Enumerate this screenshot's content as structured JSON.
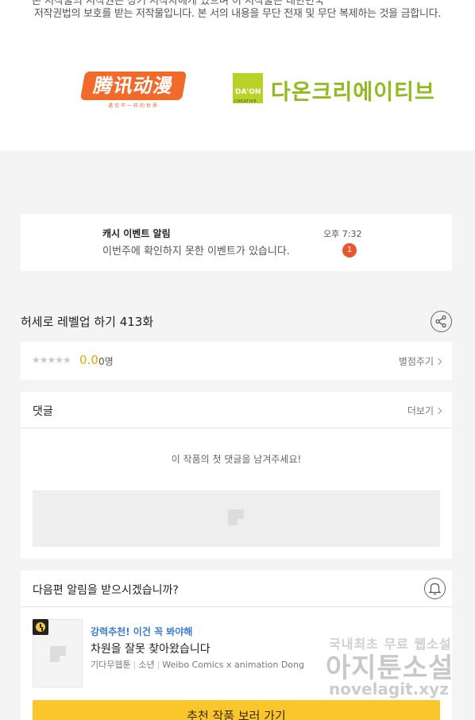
{
  "header": {
    "cut_line": "본 저작물의 저작권은 상기 저작자에게 있으며 이 저작물은 대한민국",
    "copyright": "저작권법의 보호를 받는 저작물입니다. 본 서의 내용을 무단 전재 및 무단 복제하는 것을 금합니다."
  },
  "logos": {
    "tencent_main": "腾讯动漫",
    "tencent_sub": "遇见不一样的世界",
    "daon_box": "DA'ON",
    "daon_box_sub": "CREATIVE",
    "daon_text": "다온크리에이티브"
  },
  "notification": {
    "title": "캐시 이벤트 알림",
    "time": "오후 7:32",
    "message": "이번주에 확인하지 못한 이벤트가 있습니다.",
    "badge": "1"
  },
  "episode": {
    "title": "허세로 레벨업 하기 413화",
    "share_icon": "share-icon"
  },
  "rating": {
    "stars": "★★★★★",
    "score": "0.0",
    "count": "0명",
    "rate_button": "별점주기"
  },
  "comments": {
    "header": "댓글",
    "more": "더보기",
    "empty_text": "이 작품의 첫 댓글을 남겨주세요!"
  },
  "subscribe": {
    "question": "다음편 알림을 받으시겠습니까?",
    "bell_icon": "bell-icon",
    "recommend_label": "강력추천! 이건 꼭 봐야해",
    "recommend_title": "차원을 잘못 찾아왔습니다",
    "meta_genre1": "기다무웹툰",
    "meta_genre2": "소년",
    "meta_author": "Weibo Comics x animation Dong",
    "go_button": "추천 작품 보러 가기"
  },
  "watermark": {
    "line1": "국내최초 무료 웹소설",
    "line2": "아지툰소설",
    "line3": "novelagit.xyz"
  }
}
